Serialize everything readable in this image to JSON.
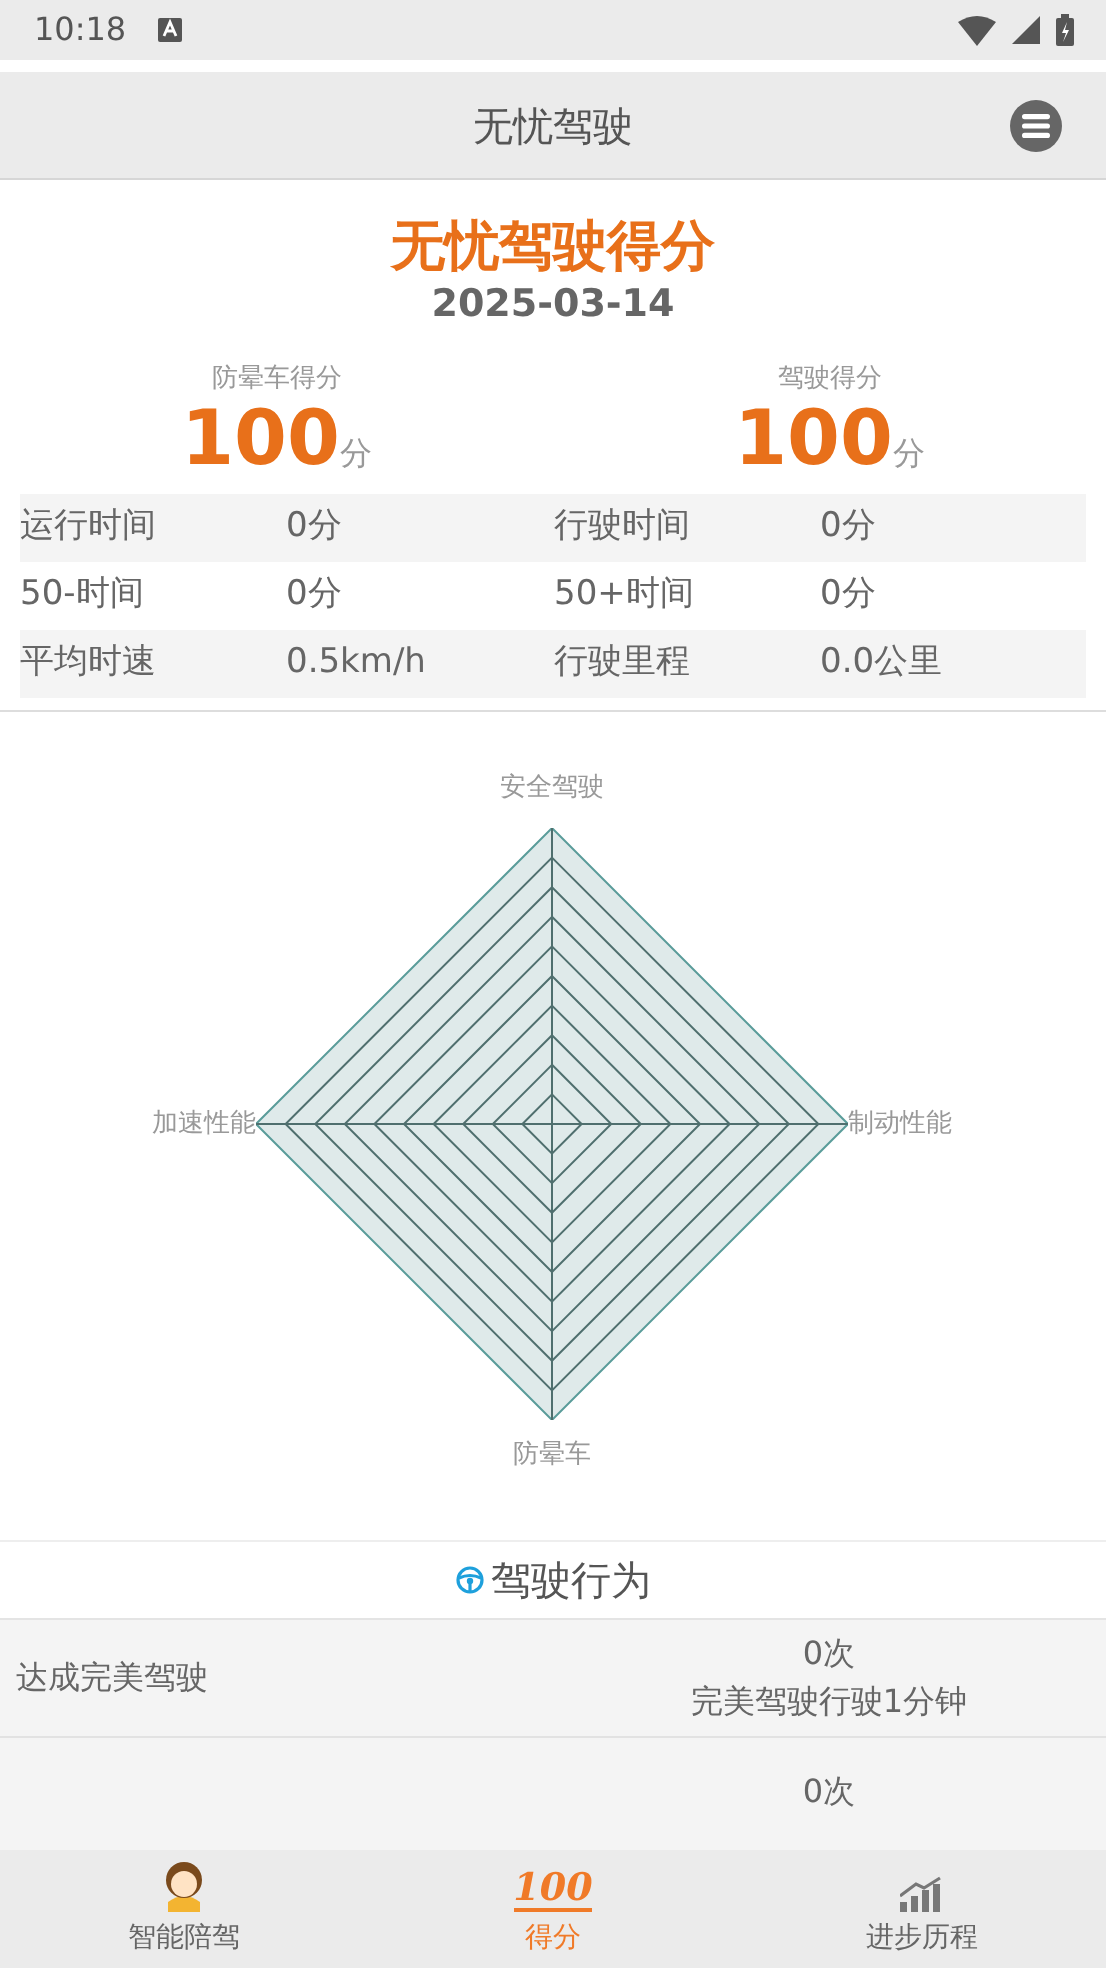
{
  "status_bar": {
    "time": "10:18"
  },
  "header": {
    "title": "无忧驾驶"
  },
  "summary": {
    "title": "无忧驾驶得分",
    "date": "2025-03-14",
    "scores": [
      {
        "label": "防晕车得分",
        "value": "100",
        "unit": "分"
      },
      {
        "label": "驾驶得分",
        "value": "100",
        "unit": "分"
      }
    ],
    "stats": [
      [
        {
          "label": "运行时间",
          "value": "0分"
        },
        {
          "label": "行驶时间",
          "value": "0分"
        }
      ],
      [
        {
          "label": "50-时间",
          "value": "0分"
        },
        {
          "label": "50+时间",
          "value": "0分"
        }
      ],
      [
        {
          "label": "平均时速",
          "value": "0.5km/h"
        },
        {
          "label": "行驶里程",
          "value": "0.0公里"
        }
      ]
    ]
  },
  "radar": {
    "axes": [
      "安全驾驶",
      "制动性能",
      "防晕车",
      "加速性能"
    ]
  },
  "behavior": {
    "title": "驾驶行为",
    "rows": [
      {
        "label": "达成完美驾驶",
        "count": "0次",
        "note": "完美驾驶行驶1分钟"
      },
      {
        "count": "0次"
      }
    ]
  },
  "tabs": [
    {
      "label": "智能陪驾",
      "kind": "avatar",
      "selected": false
    },
    {
      "label": "得分",
      "kind": "score",
      "icon_text": "100",
      "selected": true
    },
    {
      "label": "进步历程",
      "kind": "chart",
      "selected": false
    }
  ]
}
